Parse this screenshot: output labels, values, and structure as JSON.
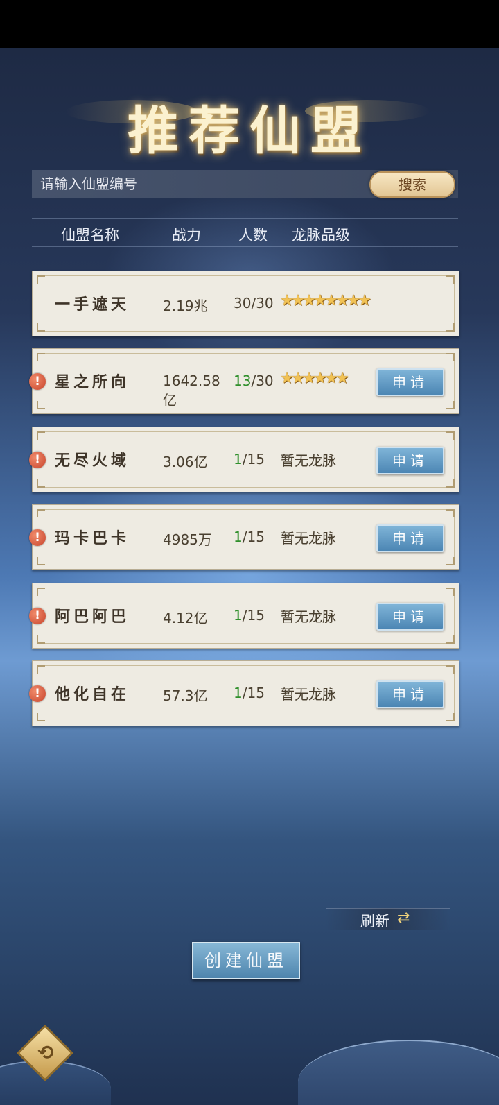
{
  "title": "推荐仙盟",
  "search": {
    "placeholder": "请输入仙盟编号",
    "button_label": "搜索"
  },
  "columns": {
    "name": "仙盟名称",
    "power": "战力",
    "members": "人数",
    "dragon": "龙脉品级"
  },
  "alliances": [
    {
      "name": "一手遮天",
      "power": "2.19兆",
      "members_current": "30",
      "members_max": "/30",
      "stars": 8,
      "dragon_text": "",
      "applicable": false,
      "alert": false
    },
    {
      "name": "星之所向",
      "power": "1642.58亿",
      "members_current": "13",
      "members_max": "/30",
      "stars": 6,
      "dragon_text": "",
      "applicable": true,
      "alert": true
    },
    {
      "name": "无尽火域",
      "power": "3.06亿",
      "members_current": "1",
      "members_max": "/15",
      "stars": 0,
      "dragon_text": "暂无龙脉",
      "applicable": true,
      "alert": true
    },
    {
      "name": "玛卡巴卡",
      "power": "4985万",
      "members_current": "1",
      "members_max": "/15",
      "stars": 0,
      "dragon_text": "暂无龙脉",
      "applicable": true,
      "alert": true
    },
    {
      "name": "阿巴阿巴",
      "power": "4.12亿",
      "members_current": "1",
      "members_max": "/15",
      "stars": 0,
      "dragon_text": "暂无龙脉",
      "applicable": true,
      "alert": true
    },
    {
      "name": "他化自在",
      "power": "57.3亿",
      "members_current": "1",
      "members_max": "/15",
      "stars": 0,
      "dragon_text": "暂无龙脉",
      "applicable": true,
      "alert": true
    }
  ],
  "apply_label": "申请",
  "refresh_label": "刷新",
  "create_label": "创建仙盟",
  "icons": {
    "alert": "exclamation-icon",
    "star": "star-icon",
    "refresh": "refresh-icon",
    "back": "back-emblem-icon"
  },
  "colors": {
    "member_green": "#2f8f2b",
    "star_gold": "#f1c255"
  }
}
